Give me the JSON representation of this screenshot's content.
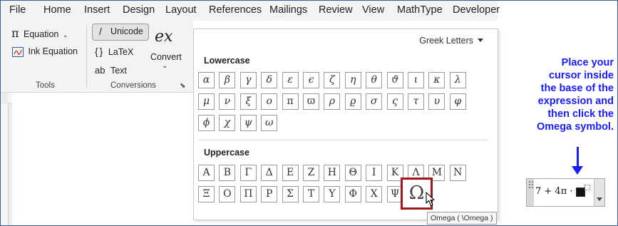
{
  "tabs": [
    "File",
    "Home",
    "Insert",
    "Design",
    "Layout",
    "References",
    "Mailings",
    "Review",
    "View",
    "MathType",
    "Developer"
  ],
  "ribbon": {
    "equation": "Equation",
    "ink_equation": "Ink Equation",
    "tools_label": "Tools",
    "unicode": "Unicode",
    "latex": "LaTeX",
    "text": "Text",
    "convert": "Convert",
    "conversions_label": "Conversions",
    "pi_glyph": "π",
    "slash_glyph": "/",
    "braces_glyph": "{}",
    "ab_glyph": "ab",
    "ex_glyph": "ex"
  },
  "panel": {
    "selector": "Greek Letters",
    "lowercase_title": "Lowercase",
    "uppercase_title": "Uppercase",
    "lowercase": [
      "α",
      "β",
      "γ",
      "δ",
      "ε",
      "ϵ",
      "ζ",
      "η",
      "θ",
      "ϑ",
      "ι",
      "κ",
      "λ",
      "μ",
      "ν",
      "ξ",
      "ο",
      "π",
      "ϖ",
      "ρ",
      "ϱ",
      "σ",
      "ς",
      "τ",
      "υ",
      "φ",
      "ϕ",
      "χ",
      "ψ",
      "ω"
    ],
    "uppercase": [
      "A",
      "B",
      "Γ",
      "Δ",
      "E",
      "Z",
      "H",
      "Θ",
      "I",
      "K",
      "Λ",
      "M",
      "N",
      "Ξ",
      "O",
      "Π",
      "P",
      "Σ",
      "T",
      "Υ",
      "Φ",
      "X",
      "Ψ"
    ],
    "omega": "Ω",
    "tooltip": "Omega ( \\Omega )"
  },
  "instruction": "Place your\ncursor inside\nthe base of the\nexpression and\nthen click the\nOmega symbol.",
  "equation": {
    "text": "7 + 4π ·"
  },
  "colors": {
    "accent_blue": "#1a1aff",
    "highlight_red": "#a01818",
    "frame": "#3a5f9a"
  }
}
